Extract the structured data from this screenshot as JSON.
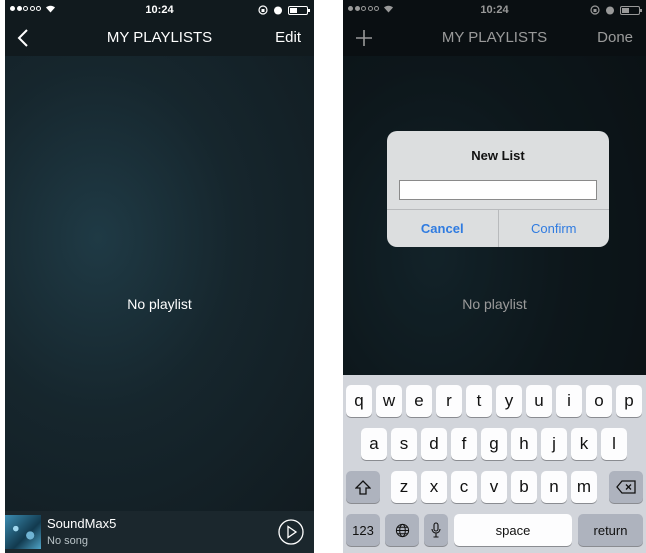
{
  "status": {
    "time": "10:24"
  },
  "left": {
    "nav": {
      "title": "MY PLAYLISTS",
      "action": "Edit",
      "back_icon": "chevron-left-icon"
    },
    "empty_text": "No playlist",
    "player": {
      "title": "SoundMax5",
      "subtitle": "No song",
      "play_icon": "play-circle-icon"
    }
  },
  "right": {
    "nav": {
      "title": "MY PLAYLISTS",
      "action": "Done",
      "add_icon": "plus-icon"
    },
    "empty_text": "No playlist",
    "dialog": {
      "title": "New List",
      "input_value": "",
      "cancel_label": "Cancel",
      "confirm_label": "Confirm"
    },
    "keyboard": {
      "row1": [
        "q",
        "w",
        "e",
        "r",
        "t",
        "y",
        "u",
        "i",
        "o",
        "p"
      ],
      "row2": [
        "a",
        "s",
        "d",
        "f",
        "g",
        "h",
        "j",
        "k",
        "l"
      ],
      "row3": [
        "z",
        "x",
        "c",
        "v",
        "b",
        "n",
        "m"
      ],
      "numbers_label": "123",
      "space_label": "space",
      "return_label": "return"
    }
  },
  "colors": {
    "accent": "#2f7be0",
    "background": "#152126",
    "bar": "#111a1e"
  }
}
